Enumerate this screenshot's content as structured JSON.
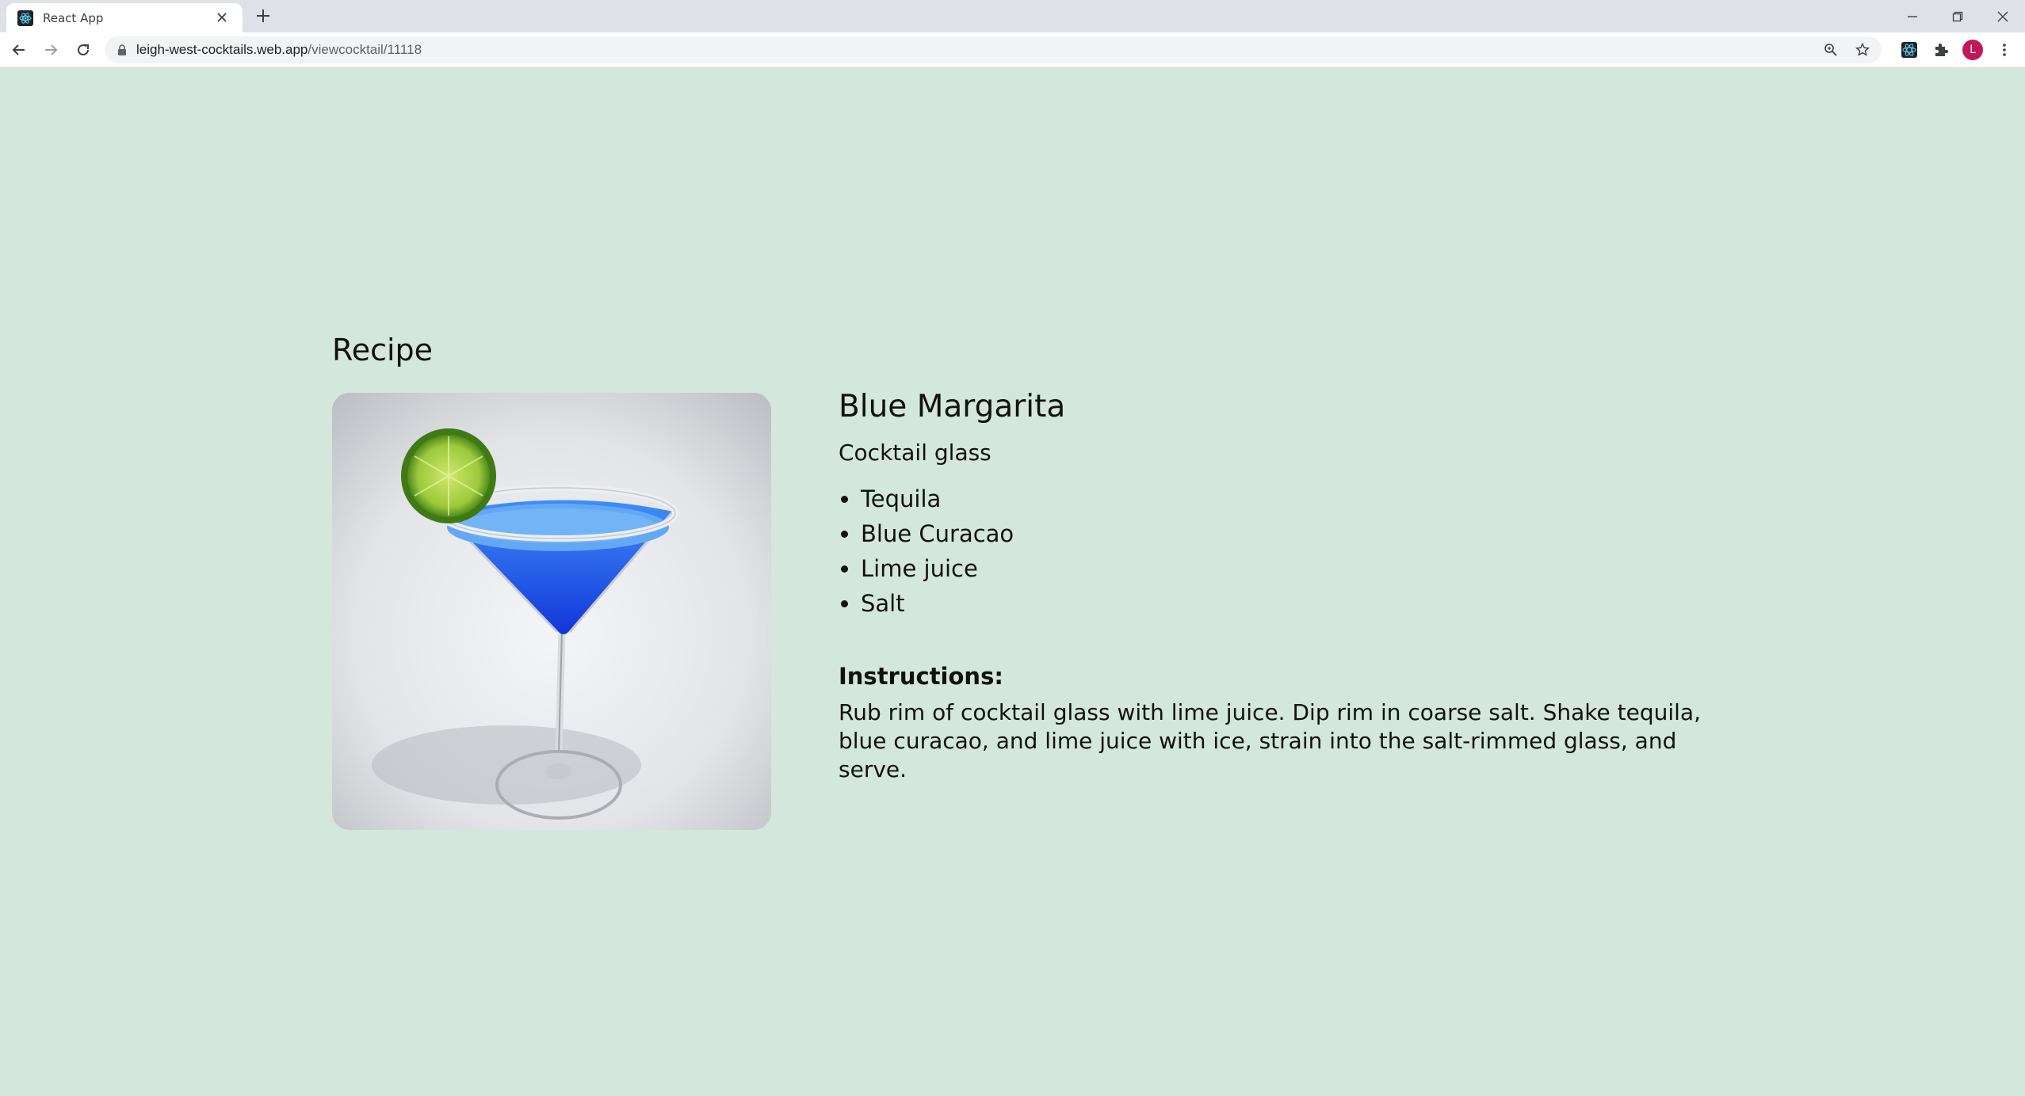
{
  "browser": {
    "tab_title": "React App",
    "url_host": "leigh-west-cocktails.web.app",
    "url_path": "/viewcocktail/11118",
    "avatar_letter": "L"
  },
  "page": {
    "heading": "Recipe"
  },
  "cocktail": {
    "name": "Blue Margarita",
    "glass": "Cocktail glass",
    "ingredients": [
      "Tequila",
      "Blue Curacao",
      "Lime juice",
      "Salt"
    ],
    "instructions_label": "Instructions:",
    "instructions": "Rub rim of cocktail glass with lime juice. Dip rim in coarse salt. Shake tequila, blue curacao, and lime juice with ice, strain into the salt-rimmed glass, and serve."
  },
  "colors": {
    "page_background": "#d3e7dc",
    "drink_blue": "#1a5cf0",
    "avatar": "#c2185b"
  }
}
